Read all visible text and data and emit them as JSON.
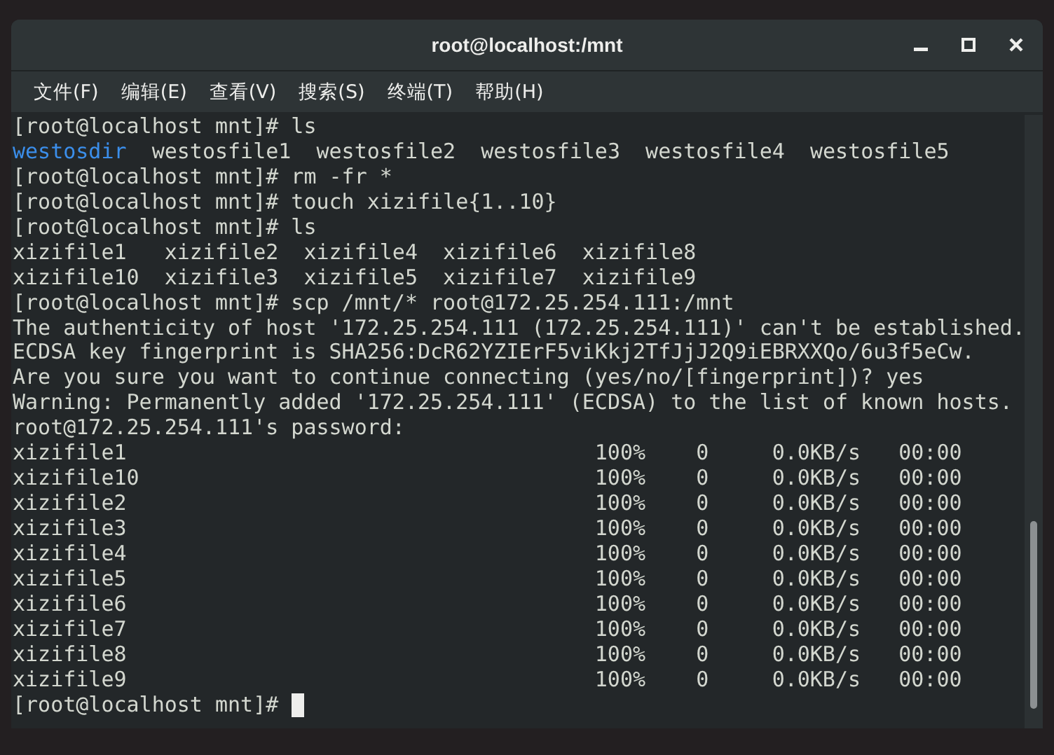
{
  "window": {
    "title": "root@localhost:/mnt"
  },
  "menu": [
    "文件(F)",
    "编辑(E)",
    "查看(V)",
    "搜索(S)",
    "终端(T)",
    "帮助(H)"
  ],
  "terminal": {
    "lines": [
      {
        "kind": "text",
        "parts": [
          {
            "text": "[root@localhost mnt]# ls",
            "kind": "plain"
          }
        ]
      },
      {
        "kind": "text",
        "parts": [
          {
            "text": "westosdir",
            "kind": "dir"
          },
          {
            "text": "  westosfile1  westosfile2  westosfile3  westosfile4  westosfile5",
            "kind": "plain"
          }
        ]
      },
      {
        "kind": "text",
        "parts": [
          {
            "text": "[root@localhost mnt]# rm -fr *",
            "kind": "plain"
          }
        ]
      },
      {
        "kind": "text",
        "parts": [
          {
            "text": "[root@localhost mnt]# touch xizifile{1..10}",
            "kind": "plain"
          }
        ]
      },
      {
        "kind": "text",
        "parts": [
          {
            "text": "[root@localhost mnt]# ls",
            "kind": "plain"
          }
        ]
      },
      {
        "kind": "text",
        "parts": [
          {
            "text": "xizifile1   xizifile2  xizifile4  xizifile6  xizifile8",
            "kind": "plain"
          }
        ]
      },
      {
        "kind": "text",
        "parts": [
          {
            "text": "xizifile10  xizifile3  xizifile5  xizifile7  xizifile9",
            "kind": "plain"
          }
        ]
      },
      {
        "kind": "text",
        "parts": [
          {
            "text": "[root@localhost mnt]# scp /mnt/* root@172.25.254.111:/mnt",
            "kind": "plain"
          }
        ]
      },
      {
        "kind": "text",
        "parts": [
          {
            "text": "The authenticity of host '172.25.254.111 (172.25.254.111)' can't be established.",
            "kind": "plain"
          }
        ]
      },
      {
        "kind": "text",
        "parts": [
          {
            "text": "ECDSA key fingerprint is SHA256:DcR62YZIErF5viKkj2TfJjJ2Q9iEBRXXQo/6u3f5eCw.",
            "kind": "plain"
          }
        ]
      },
      {
        "kind": "text",
        "parts": [
          {
            "text": "Are you sure you want to continue connecting (yes/no/[fingerprint])? yes",
            "kind": "plain"
          }
        ]
      },
      {
        "kind": "text",
        "parts": [
          {
            "text": "Warning: Permanently added '172.25.254.111' (ECDSA) to the list of known hosts.",
            "kind": "plain"
          }
        ]
      },
      {
        "kind": "text",
        "parts": [
          {
            "text": "root@172.25.254.111's password:",
            "kind": "plain"
          }
        ]
      },
      {
        "kind": "transfer",
        "file": "xizifile1",
        "percent": "100%",
        "size": "0",
        "rate": "0.0KB/s",
        "eta": "00:00"
      },
      {
        "kind": "transfer",
        "file": "xizifile10",
        "percent": "100%",
        "size": "0",
        "rate": "0.0KB/s",
        "eta": "00:00"
      },
      {
        "kind": "transfer",
        "file": "xizifile2",
        "percent": "100%",
        "size": "0",
        "rate": "0.0KB/s",
        "eta": "00:00"
      },
      {
        "kind": "transfer",
        "file": "xizifile3",
        "percent": "100%",
        "size": "0",
        "rate": "0.0KB/s",
        "eta": "00:00"
      },
      {
        "kind": "transfer",
        "file": "xizifile4",
        "percent": "100%",
        "size": "0",
        "rate": "0.0KB/s",
        "eta": "00:00"
      },
      {
        "kind": "transfer",
        "file": "xizifile5",
        "percent": "100%",
        "size": "0",
        "rate": "0.0KB/s",
        "eta": "00:00"
      },
      {
        "kind": "transfer",
        "file": "xizifile6",
        "percent": "100%",
        "size": "0",
        "rate": "0.0KB/s",
        "eta": "00:00"
      },
      {
        "kind": "transfer",
        "file": "xizifile7",
        "percent": "100%",
        "size": "0",
        "rate": "0.0KB/s",
        "eta": "00:00"
      },
      {
        "kind": "transfer",
        "file": "xizifile8",
        "percent": "100%",
        "size": "0",
        "rate": "0.0KB/s",
        "eta": "00:00"
      },
      {
        "kind": "transfer",
        "file": "xizifile9",
        "percent": "100%",
        "size": "0",
        "rate": "0.0KB/s",
        "eta": "00:00"
      },
      {
        "kind": "prompt",
        "parts": [
          {
            "text": "[root@localhost mnt]# ",
            "kind": "plain"
          }
        ]
      }
    ]
  }
}
